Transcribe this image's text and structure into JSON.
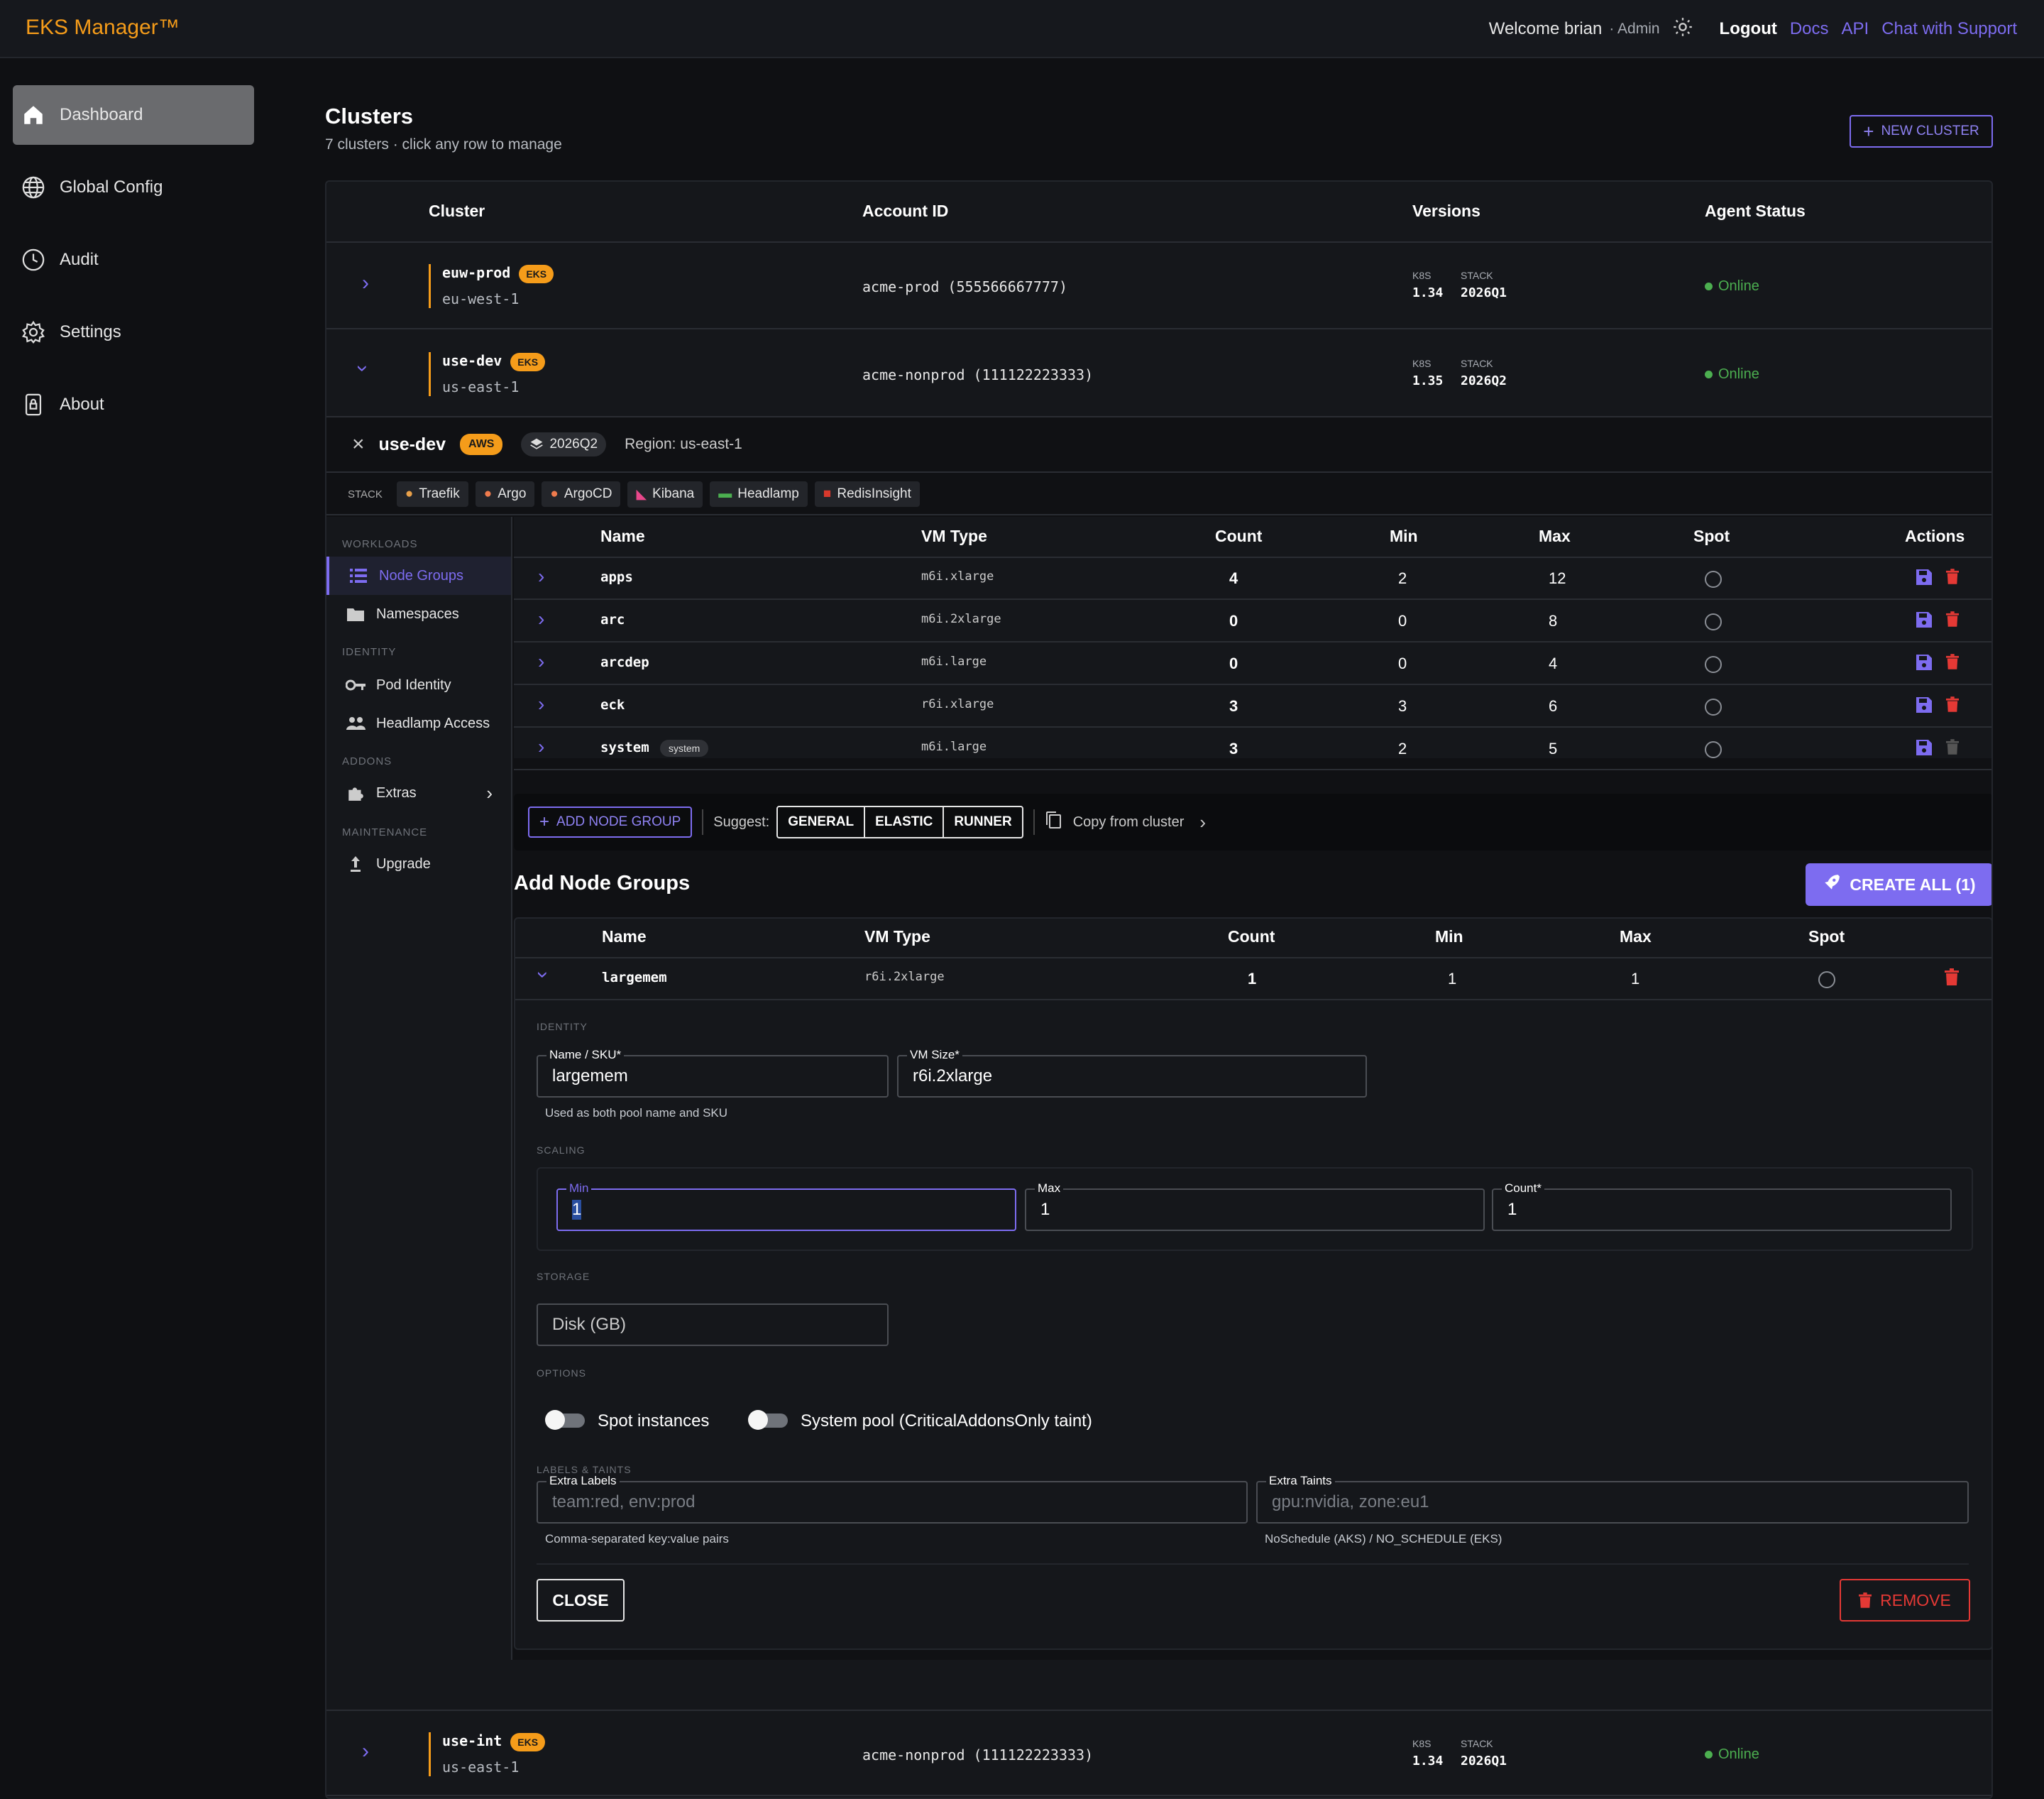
{
  "app": {
    "title": "EKS Manager™"
  },
  "header": {
    "welcome": "Welcome brian",
    "role": "· Admin",
    "logout": "Logout",
    "docs": "Docs",
    "api": "API",
    "support": "Chat with Support"
  },
  "sidebar": {
    "items": [
      {
        "label": "Dashboard",
        "icon": "home-icon"
      },
      {
        "label": "Global Config",
        "icon": "globe-icon"
      },
      {
        "label": "Audit",
        "icon": "clock-icon"
      },
      {
        "label": "Settings",
        "icon": "gear-icon"
      },
      {
        "label": "About",
        "icon": "lock-icon"
      }
    ]
  },
  "page": {
    "title": "Clusters",
    "subtitle": "7 clusters · click any row to manage",
    "new_cluster": "NEW CLUSTER"
  },
  "table": {
    "headers": {
      "cluster": "Cluster",
      "account": "Account ID",
      "versions": "Versions",
      "agent": "Agent Status"
    },
    "k8s_label": "K8S",
    "stack_label": "STACK",
    "rows": [
      {
        "name": "euw-prod",
        "badge": "EKS",
        "region": "eu-west-1",
        "account": "acme-prod (555566667777)",
        "k8s": "1.34",
        "stack": "2026Q1",
        "status": "Online"
      },
      {
        "name": "use-dev",
        "badge": "EKS",
        "region": "us-east-1",
        "account": "acme-nonprod (111122223333)",
        "k8s": "1.35",
        "stack": "2026Q2",
        "status": "Online"
      },
      {
        "name": "use-int",
        "badge": "EKS",
        "region": "us-east-1",
        "account": "acme-nonprod (111122223333)",
        "k8s": "1.34",
        "stack": "2026Q1",
        "status": "Online"
      }
    ]
  },
  "detail": {
    "name": "use-dev",
    "cloud": "AWS",
    "stack": "2026Q2",
    "region": "Region: us-east-1",
    "stack_label": "STACK",
    "stack_items": [
      "Traefik",
      "Argo",
      "ArgoCD",
      "Kibana",
      "Headlamp",
      "RedisInsight"
    ],
    "subnav": {
      "workloads": "WORKLOADS",
      "node_groups": "Node Groups",
      "namespaces": "Namespaces",
      "identity": "IDENTITY",
      "pod_identity": "Pod Identity",
      "headlamp_access": "Headlamp Access",
      "addons": "ADDONS",
      "extras": "Extras",
      "maintenance": "MAINTENANCE",
      "upgrade": "Upgrade"
    },
    "ng_headers": {
      "name": "Name",
      "vm": "VM Type",
      "count": "Count",
      "min": "Min",
      "max": "Max",
      "spot": "Spot",
      "actions": "Actions"
    },
    "node_groups": [
      {
        "name": "apps",
        "vm": "m6i.xlarge",
        "count": "4",
        "min": "2",
        "max": "12",
        "tag": ""
      },
      {
        "name": "arc",
        "vm": "m6i.2xlarge",
        "count": "0",
        "min": "0",
        "max": "8",
        "tag": ""
      },
      {
        "name": "arcdep",
        "vm": "m6i.large",
        "count": "0",
        "min": "0",
        "max": "4",
        "tag": ""
      },
      {
        "name": "eck",
        "vm": "r6i.xlarge",
        "count": "3",
        "min": "3",
        "max": "6",
        "tag": ""
      },
      {
        "name": "system",
        "vm": "m6i.large",
        "count": "3",
        "min": "2",
        "max": "5",
        "tag": "system"
      }
    ],
    "toolbar": {
      "add": "ADD NODE GROUP",
      "suggest": "Suggest:",
      "general": "GENERAL",
      "elastic": "ELASTIC",
      "runner": "RUNNER",
      "copy": "Copy from cluster"
    },
    "add": {
      "title": "Add Node Groups",
      "create": "CREATE ALL (1)",
      "row": {
        "name": "largemem",
        "vm": "r6i.2xlarge",
        "count": "1",
        "min": "1",
        "max": "1"
      },
      "identity": "IDENTITY",
      "name_label": "Name / SKU*",
      "name_value": "largemem",
      "vm_label": "VM Size*",
      "vm_value": "r6i.2xlarge",
      "name_hint": "Used as both pool name and SKU",
      "scaling": "SCALING",
      "min_label": "Min",
      "min_value": "1",
      "max_label": "Max",
      "max_value": "1",
      "count_label": "Count*",
      "count_value": "1",
      "storage": "STORAGE",
      "disk_placeholder": "Disk (GB)",
      "options": "OPTIONS",
      "spot": "Spot instances",
      "system": "System pool (CriticalAddonsOnly taint)",
      "labels_taints": "LABELS & TAINTS",
      "labels_label": "Extra Labels",
      "labels_placeholder": "team:red, env:prod",
      "labels_hint": "Comma-separated key:value pairs",
      "taints_label": "Extra Taints",
      "taints_placeholder": "gpu:nvidia, zone:eu1",
      "taints_hint": "NoSchedule (AKS) / NO_SCHEDULE (EKS)",
      "close": "CLOSE",
      "remove": "REMOVE"
    }
  },
  "colors": {
    "accent": "#7d6cf0",
    "brand": "#f59c1a",
    "online": "#4caf50",
    "danger": "#e53935"
  }
}
